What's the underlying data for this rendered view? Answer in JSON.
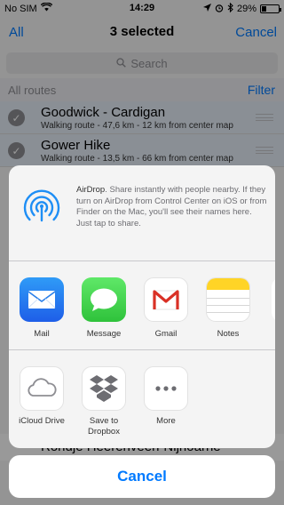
{
  "status_bar": {
    "carrier": "No SIM",
    "time": "14:29",
    "battery_percent": "29%",
    "battery_level": 0.29,
    "icons": [
      "wifi-icon",
      "location-arrow-icon",
      "alarm-icon",
      "bluetooth-icon",
      "battery-icon"
    ]
  },
  "nav": {
    "left_label": "All",
    "title": "3 selected",
    "right_label": "Cancel"
  },
  "search": {
    "placeholder": "Search",
    "icon": "search-icon"
  },
  "section": {
    "title": "All routes",
    "filter_label": "Filter"
  },
  "routes": [
    {
      "title": "Goodwick - Cardigan",
      "subtitle": "Walking route - 47,6 km - 12 km from center map",
      "selected": true
    },
    {
      "title": "Gower Hike",
      "subtitle": "Walking route - 13,5 km - 66 km from center map",
      "selected": true
    }
  ],
  "peek_route": {
    "title": "Rondje Heerenveen-Nijhoarne"
  },
  "share_sheet": {
    "airdrop": {
      "title": "AirDrop",
      "description": "Share instantly with people nearby. If they turn on AirDrop from Control Center on iOS or from Finder on the Mac, you'll see their names here. Just tap to share."
    },
    "apps": [
      {
        "label": "Mail",
        "icon": "mail-icon"
      },
      {
        "label": "Message",
        "icon": "message-icon"
      },
      {
        "label": "Gmail",
        "icon": "gmail-icon"
      },
      {
        "label": "Notes",
        "icon": "notes-icon"
      }
    ],
    "actions": [
      {
        "label": "iCloud Drive",
        "icon": "icloud-icon"
      },
      {
        "label": "Save to Dropbox",
        "icon": "dropbox-icon"
      },
      {
        "label": "More",
        "icon": "more-icon"
      }
    ],
    "cancel_label": "Cancel"
  },
  "colors": {
    "accent": "#007aff",
    "mail": "#1e5ee8",
    "message": "#2fc23b",
    "gmail_red": "#d93025",
    "notes_yellow": "#ffd426"
  }
}
